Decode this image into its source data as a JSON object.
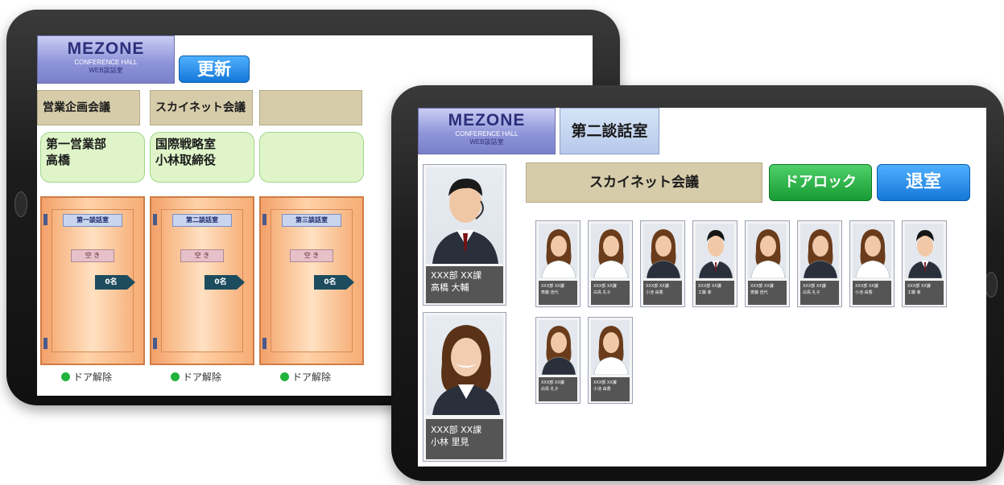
{
  "left_screen": {
    "logo": {
      "title": "MEZONE",
      "line1": "CONFERENCE HALL",
      "line2": "WEB談話室"
    },
    "refresh_label": "更新",
    "rooms": [
      {
        "meeting": "営業企画会議",
        "dept": "第一営業部",
        "person": "高橋",
        "room_name": "第一談話室",
        "status": "空 き",
        "count": "0名",
        "door_label": "ドア解除"
      },
      {
        "meeting": "スカイネット会議",
        "dept": "国際戦略室",
        "person": "小林取締役",
        "room_name": "第二談話室",
        "status": "空 き",
        "count": "0名",
        "door_label": "ドア解除"
      },
      {
        "meeting": "",
        "dept": "",
        "person": "",
        "room_name": "第三談話室",
        "status": "空 き",
        "count": "0名",
        "door_label": "ドア解除"
      }
    ]
  },
  "right_screen": {
    "logo": {
      "title": "MEZONE",
      "line1": "CONFERENCE HALL",
      "line2": "WEB談話室"
    },
    "room_title": "第二談話室",
    "meeting_name": "スカイネット会議",
    "door_lock_label": "ドアロック",
    "exit_label": "退室",
    "hosts": [
      {
        "dept": "XXX部 XX課",
        "name": "高橋 大輔",
        "gender": "male"
      },
      {
        "dept": "XXX部 XX課",
        "name": "小林 里見",
        "gender": "female"
      }
    ],
    "participants": [
      {
        "dept": "XXX部 XX課",
        "name": "斎藤 佳代",
        "gender": "female"
      },
      {
        "dept": "XXX部 XX課",
        "name": "白鳥 礼子",
        "gender": "female"
      },
      {
        "dept": "XXX部 XX課",
        "name": "小池 由香",
        "gender": "female"
      },
      {
        "dept": "XXX部 XX課",
        "name": "工藤 孝",
        "gender": "male"
      },
      {
        "dept": "XXX部 XX課",
        "name": "斎藤 佳代",
        "gender": "female"
      },
      {
        "dept": "XXX部 XX課",
        "name": "白鳥 礼子",
        "gender": "female"
      },
      {
        "dept": "XXX部 XX課",
        "name": "小池 由香",
        "gender": "female"
      },
      {
        "dept": "XXX部 XX課",
        "name": "工藤 孝",
        "gender": "male"
      },
      {
        "dept": "XXX部 XX課",
        "name": "白鳥 礼子",
        "gender": "female"
      },
      {
        "dept": "XXX部 XX課",
        "name": "小池 由香",
        "gender": "female"
      }
    ]
  }
}
